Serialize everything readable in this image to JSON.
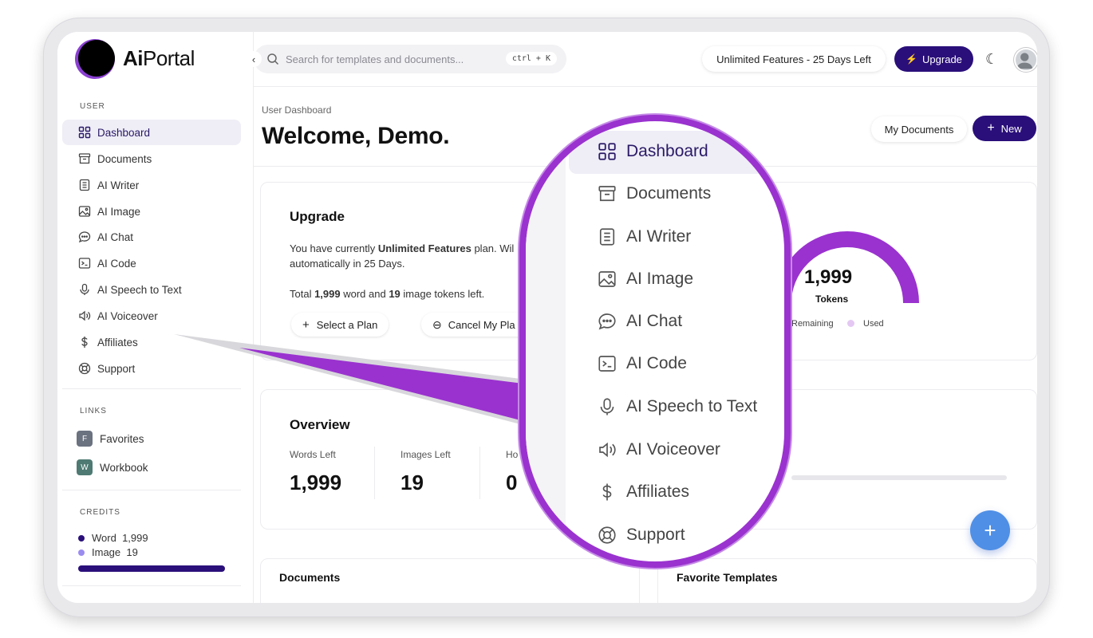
{
  "app": {
    "logo_bold": "Ai",
    "logo_rest": "Portal"
  },
  "sidebar": {
    "user_label": "USER",
    "items": [
      {
        "label": "Dashboard",
        "icon": "dashboard-icon"
      },
      {
        "label": "Documents",
        "icon": "archive-icon"
      },
      {
        "label": "AI Writer",
        "icon": "document-icon"
      },
      {
        "label": "AI Image",
        "icon": "image-icon"
      },
      {
        "label": "AI Chat",
        "icon": "chat-icon"
      },
      {
        "label": "AI Code",
        "icon": "terminal-icon"
      },
      {
        "label": "AI Speech to Text",
        "icon": "microphone-icon"
      },
      {
        "label": "AI Voiceover",
        "icon": "speaker-icon"
      },
      {
        "label": "Affiliates",
        "icon": "dollar-icon"
      },
      {
        "label": "Support",
        "icon": "lifebuoy-icon"
      }
    ],
    "links_label": "LINKS",
    "links": [
      {
        "badge": "F",
        "label": "Favorites",
        "color": "#6b7280"
      },
      {
        "badge": "W",
        "label": "Workbook",
        "color": "#4f7a73"
      }
    ],
    "credits_label": "CREDITS",
    "credits": [
      {
        "name": "Word",
        "value": "1,999",
        "color": "#2a0f7a"
      },
      {
        "name": "Image",
        "value": "19",
        "color": "#9b8cf0"
      }
    ]
  },
  "topbar": {
    "search_placeholder": "Search for templates and documents...",
    "search_shortcut": "ctrl + K",
    "plan_status": "Unlimited Features - 25 Days Left",
    "upgrade_label": "Upgrade"
  },
  "main": {
    "breadcrumb": "User Dashboard",
    "welcome": "Welcome, Demo.",
    "my_documents": "My Documents",
    "new_label": "New",
    "upgrade_card": {
      "title": "Upgrade",
      "line1_pre": "You have currently ",
      "line1_bold": "Unlimited Features",
      "line1_post": " plan. Wil",
      "line2": "automatically in 25 Days.",
      "tokens_pre": "Total ",
      "tokens_words": "1,999",
      "tokens_mid": " word and ",
      "tokens_images": "19",
      "tokens_post": " image tokens left.",
      "select_plan": "Select a Plan",
      "cancel_plan": "Cancel My Pla"
    },
    "gauge": {
      "value": "1,999",
      "unit": "Tokens",
      "legend_remaining": "Remaining",
      "legend_used": "Used",
      "accent": "#9a32cf",
      "used_color": "#e4c8f3"
    },
    "overview": {
      "title": "Overview",
      "stats": [
        {
          "label": "Words Left",
          "value": "1,999"
        },
        {
          "label": "Images Left",
          "value": "19"
        },
        {
          "label": "Ho",
          "value": "0"
        }
      ]
    },
    "documents_title": "Documents",
    "favorites_title": "Favorite Templates"
  },
  "magnifier": {
    "items": [
      "Dashboard",
      "Documents",
      "AI Writer",
      "AI Image",
      "AI Chat",
      "AI Code",
      "AI Speech to Text",
      "AI Voiceover",
      "Affiliates",
      "Support"
    ]
  }
}
